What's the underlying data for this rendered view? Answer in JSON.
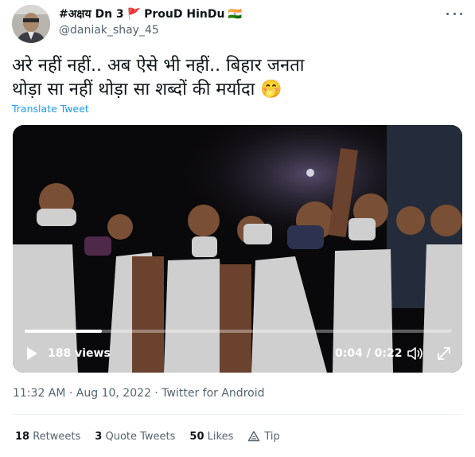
{
  "tweet": {
    "display_name": "#अक्षय Dn 3",
    "flag_emoji": "🚩",
    "display_name_2": "ProuD HinDu",
    "flag_emoji_2": "🇮🇳",
    "handle": "@daniak_shay_45",
    "text_line1": "अरे नहीं नहीं.. अब ऐसे भी नहीं.. बिहार जनता",
    "text_line2": "थोड़ा सा नहीं थोड़ा सा शब्दों की मर्यादा",
    "emoji": "🤭",
    "translate_label": "Translate Tweet",
    "timestamp": "11:32 AM · Aug 10, 2022 · Twitter for Android"
  },
  "video": {
    "views": "188 views",
    "time": "0:04 / 0:22",
    "progress_fraction": 0.18
  },
  "stats": {
    "retweets_count": "18",
    "retweets_label": "Retweets",
    "quotes_count": "3",
    "quotes_label": "Quote Tweets",
    "likes_count": "50",
    "likes_label": "Likes",
    "tip_label": "Tip"
  },
  "colors": {
    "accent": "#1d9bf0",
    "secondary_text": "#536471",
    "primary_text": "#0f1419"
  }
}
